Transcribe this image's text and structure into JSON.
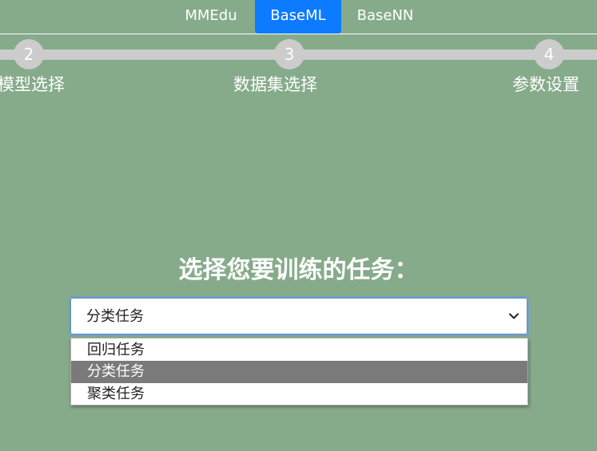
{
  "nav": {
    "tabs": [
      {
        "label": "MMEdu",
        "active": false
      },
      {
        "label": "BaseML",
        "active": true
      },
      {
        "label": "BaseNN",
        "active": false
      }
    ],
    "active_color": "#0d7bff"
  },
  "stepper": {
    "steps": [
      {
        "number": "2",
        "label": "模型选择"
      },
      {
        "number": "3",
        "label": "数据集选择"
      },
      {
        "number": "4",
        "label": "参数设置"
      }
    ],
    "track_color": "#cccccc"
  },
  "task": {
    "heading": "选择您要训练的任务：",
    "selected_value": "分类任务",
    "dropdown_icon": "chevron-down-icon",
    "options": [
      {
        "label": "回归任务",
        "highlighted": false
      },
      {
        "label": "分类任务",
        "highlighted": true
      },
      {
        "label": "聚类任务",
        "highlighted": false
      }
    ]
  },
  "colors": {
    "background": "#86ab8b",
    "option_highlight": "#7a7a7a"
  }
}
